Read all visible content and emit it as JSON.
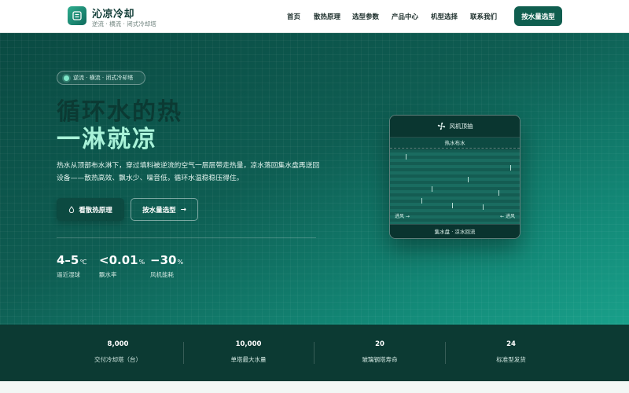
{
  "brand": {
    "name": "沁凉冷却",
    "tagline": "逆流 · 横流 · 闭式冷却塔"
  },
  "nav": {
    "items": [
      "首页",
      "散热原理",
      "选型参数",
      "产品中心",
      "机型选择",
      "联系我们"
    ],
    "cta_label": "按水量选型"
  },
  "hero": {
    "pill_text": "逆流 · 横流 · 闭式冷却塔",
    "title_line1": "循环水的热",
    "title_line2": "一淋就凉",
    "description": "热水从顶部布水淋下，穿过填料被逆流的空气一层层带走热量，凉水落回集水盘再送回设备——散热高效、飘水少、噪音低，循环水温稳稳压得住。",
    "primary_button": "看散热原理",
    "secondary_button": "按水量选型",
    "secondary_arrow": "→",
    "stats": [
      {
        "value": "4–5",
        "unit": "℃",
        "label": "逼近湿球"
      },
      {
        "value": "<0.01",
        "unit": "%",
        "label": "飘水率"
      },
      {
        "value": "−30",
        "unit": "%",
        "label": "风机能耗"
      }
    ]
  },
  "tower_card": {
    "header": "风机顶抽",
    "sub_header": "热水布水",
    "wind_left": "进风 →",
    "wind_right": "← 进风",
    "footer": "集水盘 · 凉水回流"
  },
  "stats_bar": [
    {
      "value": "8,000",
      "label": "交付冷却塔（台）"
    },
    {
      "value": "10,000",
      "label": "单塔最大水量"
    },
    {
      "value": "20",
      "label": "玻璃钢塔寿命"
    },
    {
      "value": "24",
      "label": "标准型发货"
    }
  ],
  "colors": {
    "brand_dark": "#0f5e4f",
    "accent_mint": "#a8f2d8",
    "hero_start": "#0a4a42",
    "hero_end": "#19a08a"
  }
}
